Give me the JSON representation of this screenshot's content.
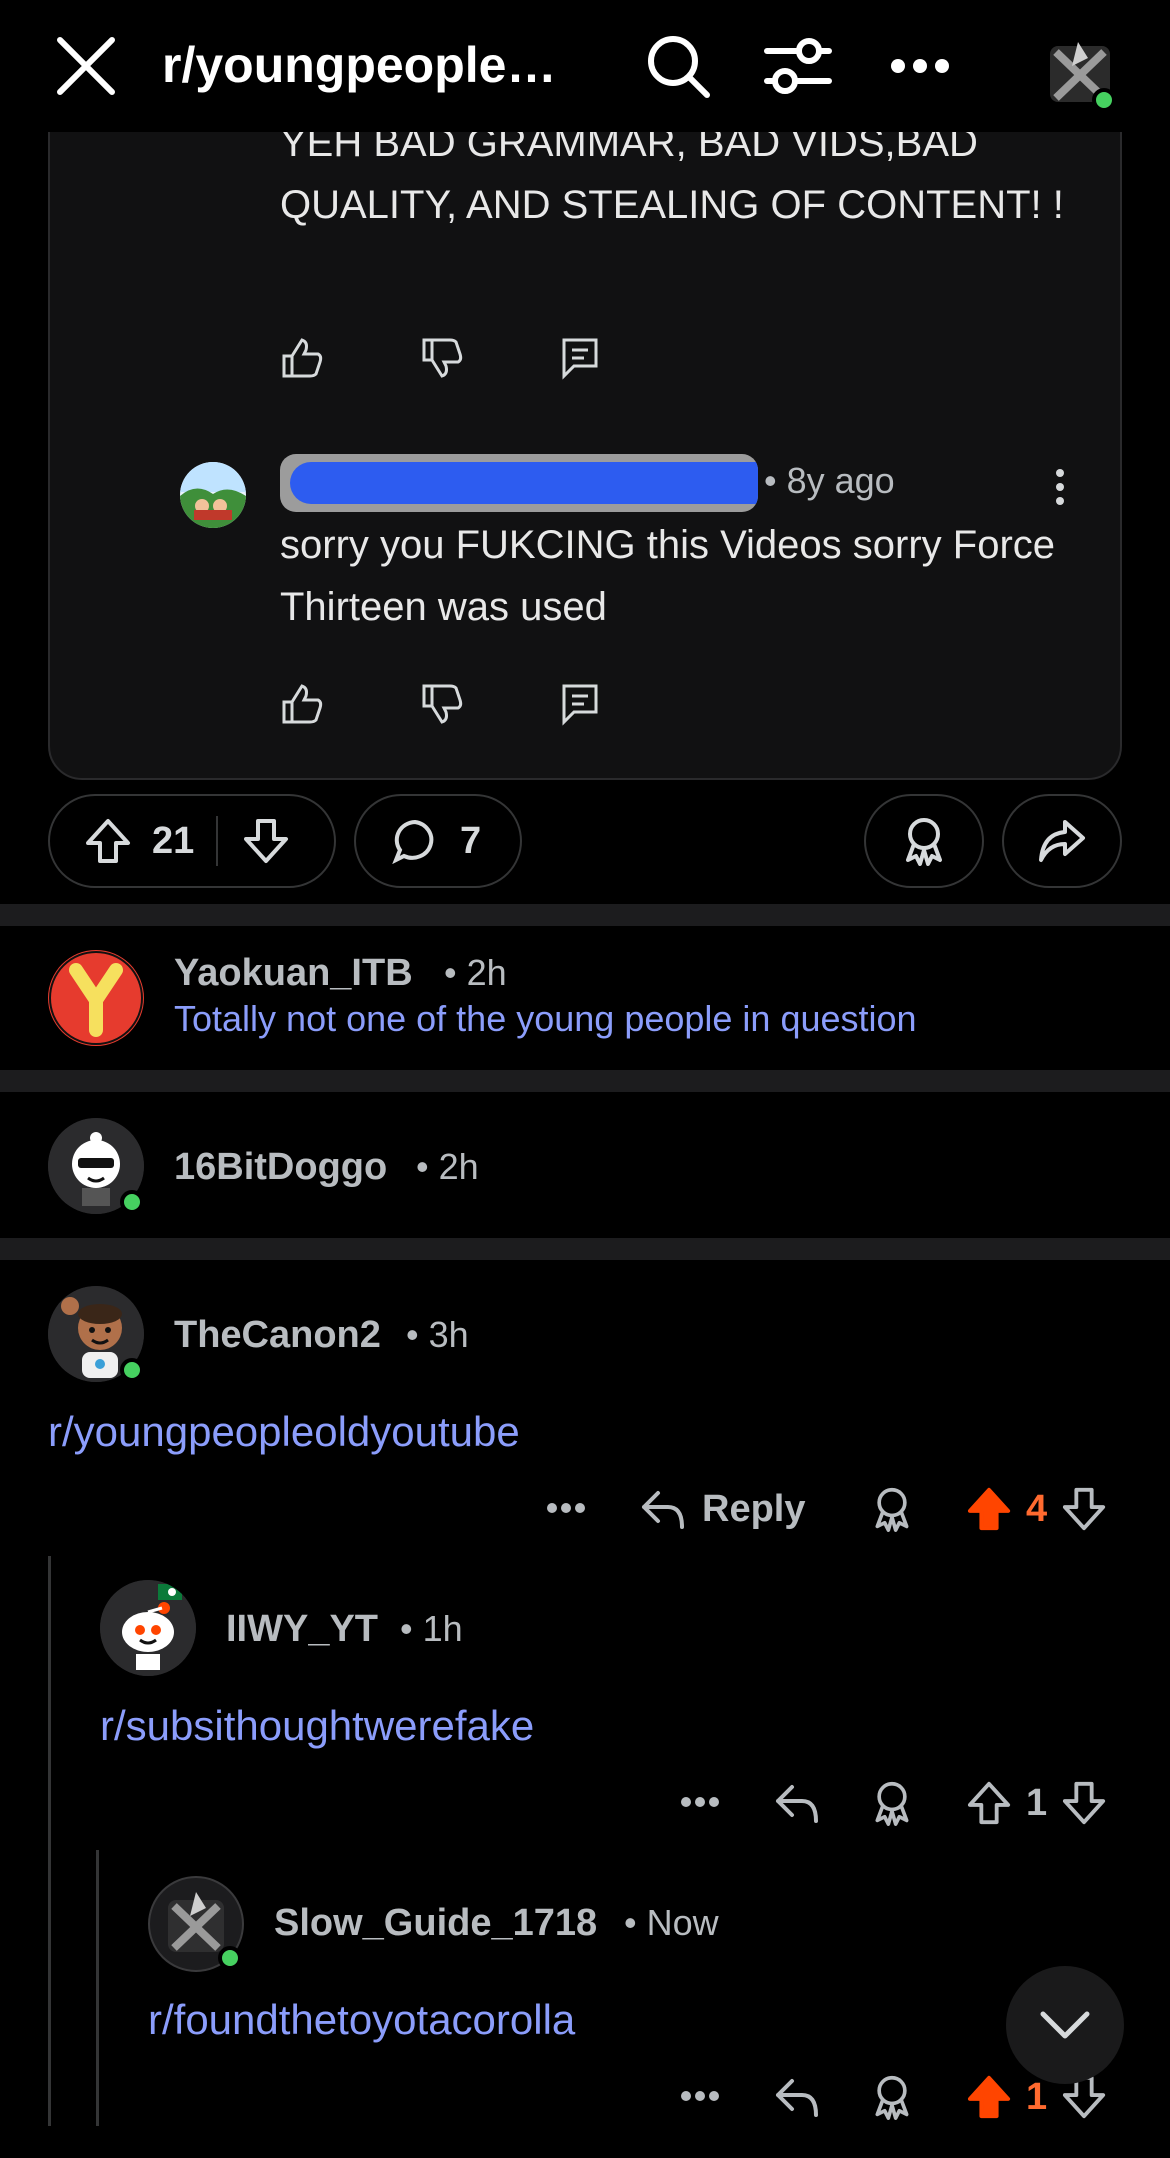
{
  "header": {
    "title": "r/youngpeople…",
    "icons": [
      "close-icon",
      "search-icon",
      "filter-icon",
      "more-icon",
      "user-avatar"
    ]
  },
  "embed": {
    "top_comment_text": "YEH BAD GRAMMAR, BAD VIDS,BAD QUALITY, AND STEALING OF CONTENT! !",
    "reply": {
      "time": "• 8y ago",
      "text": "sorry you FUKCING this Videos sorry Force Thirteen was used"
    }
  },
  "post_bar": {
    "upvotes": "21",
    "comments": "7"
  },
  "comments": [
    {
      "user": "Yaokuan_ITB",
      "time": "• 2h",
      "flair": "Totally not one of the young people in question"
    },
    {
      "user": "16BitDoggo",
      "time": "• 2h"
    },
    {
      "user": "TheCanon2",
      "time": "• 3h",
      "body": "r/youngpeopleoldyoutube",
      "reply_label": "Reply",
      "votes": "4"
    },
    {
      "user": "IIWY_YT",
      "time": "• 1h",
      "body": "r/subsithoughtwerefake",
      "votes": "1"
    },
    {
      "user": "Slow_Guide_1718",
      "time": "• Now",
      "body": "r/foundthetoyotacorolla",
      "votes": "1"
    }
  ],
  "colors": {
    "background": "#000000",
    "link": "#8b9dfb",
    "upvote_active": "#ff4500",
    "online": "#46d160",
    "muted": "#b8bcc0"
  }
}
